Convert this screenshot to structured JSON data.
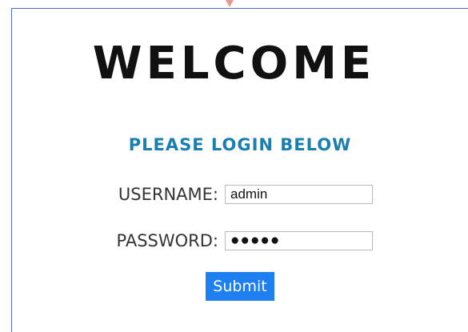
{
  "header": {
    "title": "WELCOME",
    "subtitle": "PLEASE LOGIN BELOW"
  },
  "form": {
    "username_label": "USERNAME:",
    "username_value": "admin",
    "password_label": "PASSWORD:",
    "password_value": "●●●●●",
    "submit_label": "Submit"
  },
  "colors": {
    "frame_border": "#4f6fd0",
    "subtitle": "#1a7fb0",
    "submit_bg": "#1e7ff0",
    "arrow": "#e89a8a"
  }
}
